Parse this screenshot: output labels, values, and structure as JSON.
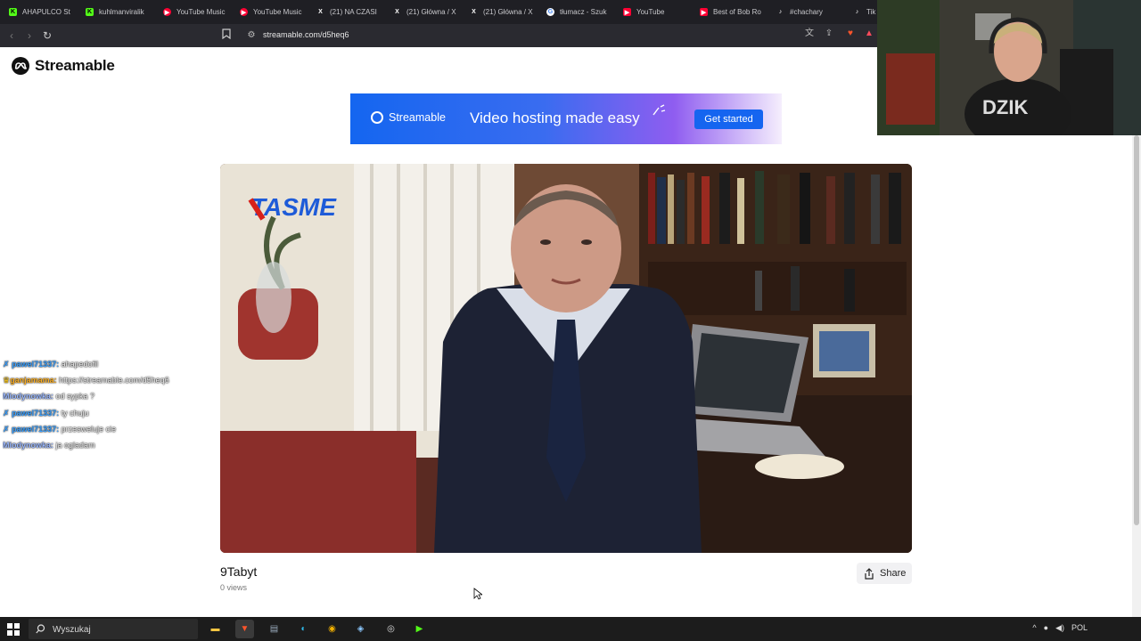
{
  "browser": {
    "tabs": [
      {
        "label": "AHAPULCO St",
        "icon": "kick-icon",
        "color": "#53fc18"
      },
      {
        "label": "kuhlmanviralik",
        "icon": "kick-icon",
        "color": "#53fc18"
      },
      {
        "label": "YouTube Music",
        "icon": "youtube-music-icon",
        "color": "#ff0033"
      },
      {
        "label": "YouTube Music",
        "icon": "youtube-music-icon",
        "color": "#ff0033"
      },
      {
        "label": "(21) NA CZASI",
        "icon": "x-icon",
        "color": "#ffffff"
      },
      {
        "label": "(21) Główna / X",
        "icon": "x-icon",
        "color": "#ffffff"
      },
      {
        "label": "(21) Główna / X",
        "icon": "x-icon",
        "color": "#ffffff"
      },
      {
        "label": "tłumacz - Szuk",
        "icon": "google-icon",
        "color": "#ffffff"
      },
      {
        "label": "YouTube",
        "icon": "youtube-icon",
        "color": "#ff0033"
      },
      {
        "label": "Best of Bob Ro",
        "icon": "youtube-icon",
        "color": "#ff0033"
      },
      {
        "label": "#chachary",
        "icon": "tiktok-icon",
        "color": "#ffffff"
      },
      {
        "label": "Tik",
        "icon": "tiktok-icon",
        "color": "#ffffff"
      }
    ],
    "url": "streamable.com/d5heq6"
  },
  "page": {
    "logo_text": "Streamable",
    "banner": {
      "brand": "Streamable",
      "tagline": "Video hosting made easy",
      "cta": "Get started"
    },
    "video": {
      "overlay_logo": "TASME",
      "title": "9Tabyt",
      "views": "0 views"
    },
    "share_label": "Share"
  },
  "chat": [
    {
      "user": "pawel71337:",
      "message": "ahapedofil",
      "user_color": "#3aa0ff"
    },
    {
      "user": "ganjamama:",
      "message": "https://streamable.com/d5heq6",
      "user_color": "#ffb020"
    },
    {
      "user": "Miodynowka:",
      "message": "od sypka ?",
      "user_color": "#9ab8ff"
    },
    {
      "user": "pawel71337:",
      "message": "ty chuju",
      "user_color": "#3aa0ff"
    },
    {
      "user": "pawel71337:",
      "message": "przesweluje cie",
      "user_color": "#3aa0ff"
    },
    {
      "user": "Miodynowka:",
      "message": "ja ogladam",
      "user_color": "#9ab8ff"
    }
  ],
  "taskbar": {
    "search_placeholder": "Wyszukaj",
    "language": "POL",
    "apps": [
      "file-explorer-icon",
      "brave-icon",
      "app-icon",
      "edge-icon",
      "chrome-icon",
      "steam-icon",
      "obs-icon",
      "kick-icon"
    ]
  }
}
